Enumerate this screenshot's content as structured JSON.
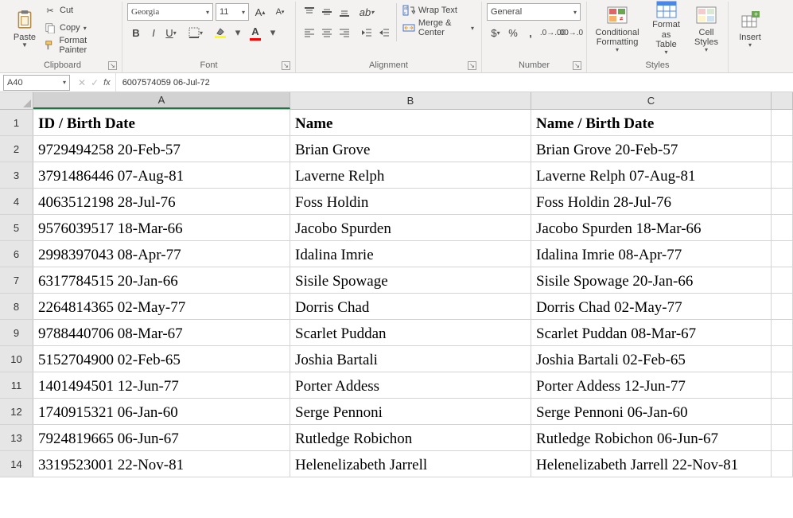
{
  "ribbon": {
    "clipboard": {
      "paste": "Paste",
      "cut": "Cut",
      "copy": "Copy",
      "format_painter": "Format Painter",
      "label": "Clipboard"
    },
    "font": {
      "font_name": "Georgia",
      "font_size": "11",
      "label": "Font"
    },
    "alignment": {
      "wrap": "Wrap Text",
      "merge": "Merge & Center",
      "label": "Alignment"
    },
    "number": {
      "format": "General",
      "label": "Number"
    },
    "styles": {
      "conditional": "Conditional\nFormatting",
      "format_as_table": "Format as\nTable",
      "cell_styles": "Cell\nStyles",
      "label": "Styles"
    },
    "cells": {
      "insert": "Insert"
    }
  },
  "namebox": "A40",
  "formula": "6007574059 06-Jul-72",
  "columns": [
    "A",
    "B",
    "C"
  ],
  "headers": [
    "ID / Birth Date",
    "Name",
    "Name / Birth Date"
  ],
  "rows": [
    {
      "n": 2,
      "a": "9729494258 20-Feb-57",
      "b": "Brian Grove",
      "c": "Brian Grove 20-Feb-57"
    },
    {
      "n": 3,
      "a": "3791486446 07-Aug-81",
      "b": "Laverne Relph",
      "c": "Laverne Relph 07-Aug-81"
    },
    {
      "n": 4,
      "a": "4063512198 28-Jul-76",
      "b": "Foss Holdin",
      "c": "Foss Holdin 28-Jul-76"
    },
    {
      "n": 5,
      "a": "9576039517 18-Mar-66",
      "b": "Jacobo Spurden",
      "c": "Jacobo Spurden 18-Mar-66"
    },
    {
      "n": 6,
      "a": "2998397043 08-Apr-77",
      "b": "Idalina Imrie",
      "c": "Idalina Imrie 08-Apr-77"
    },
    {
      "n": 7,
      "a": "6317784515 20-Jan-66",
      "b": "Sisile Spowage",
      "c": "Sisile Spowage 20-Jan-66"
    },
    {
      "n": 8,
      "a": "2264814365 02-May-77",
      "b": "Dorris Chad",
      "c": "Dorris Chad 02-May-77"
    },
    {
      "n": 9,
      "a": "9788440706 08-Mar-67",
      "b": "Scarlet Puddan",
      "c": "Scarlet Puddan 08-Mar-67"
    },
    {
      "n": 10,
      "a": "5152704900 02-Feb-65",
      "b": "Joshia Bartali",
      "c": "Joshia Bartali 02-Feb-65"
    },
    {
      "n": 11,
      "a": "1401494501 12-Jun-77",
      "b": "Porter Addess",
      "c": "Porter Addess 12-Jun-77"
    },
    {
      "n": 12,
      "a": "1740915321 06-Jan-60",
      "b": "Serge Pennoni",
      "c": "Serge Pennoni 06-Jan-60"
    },
    {
      "n": 13,
      "a": "7924819665 06-Jun-67",
      "b": "Rutledge Robichon",
      "c": "Rutledge Robichon 06-Jun-67"
    },
    {
      "n": 14,
      "a": "3319523001 22-Nov-81",
      "b": "Helenelizabeth Jarrell",
      "c": "Helenelizabeth Jarrell 22-Nov-81"
    }
  ]
}
